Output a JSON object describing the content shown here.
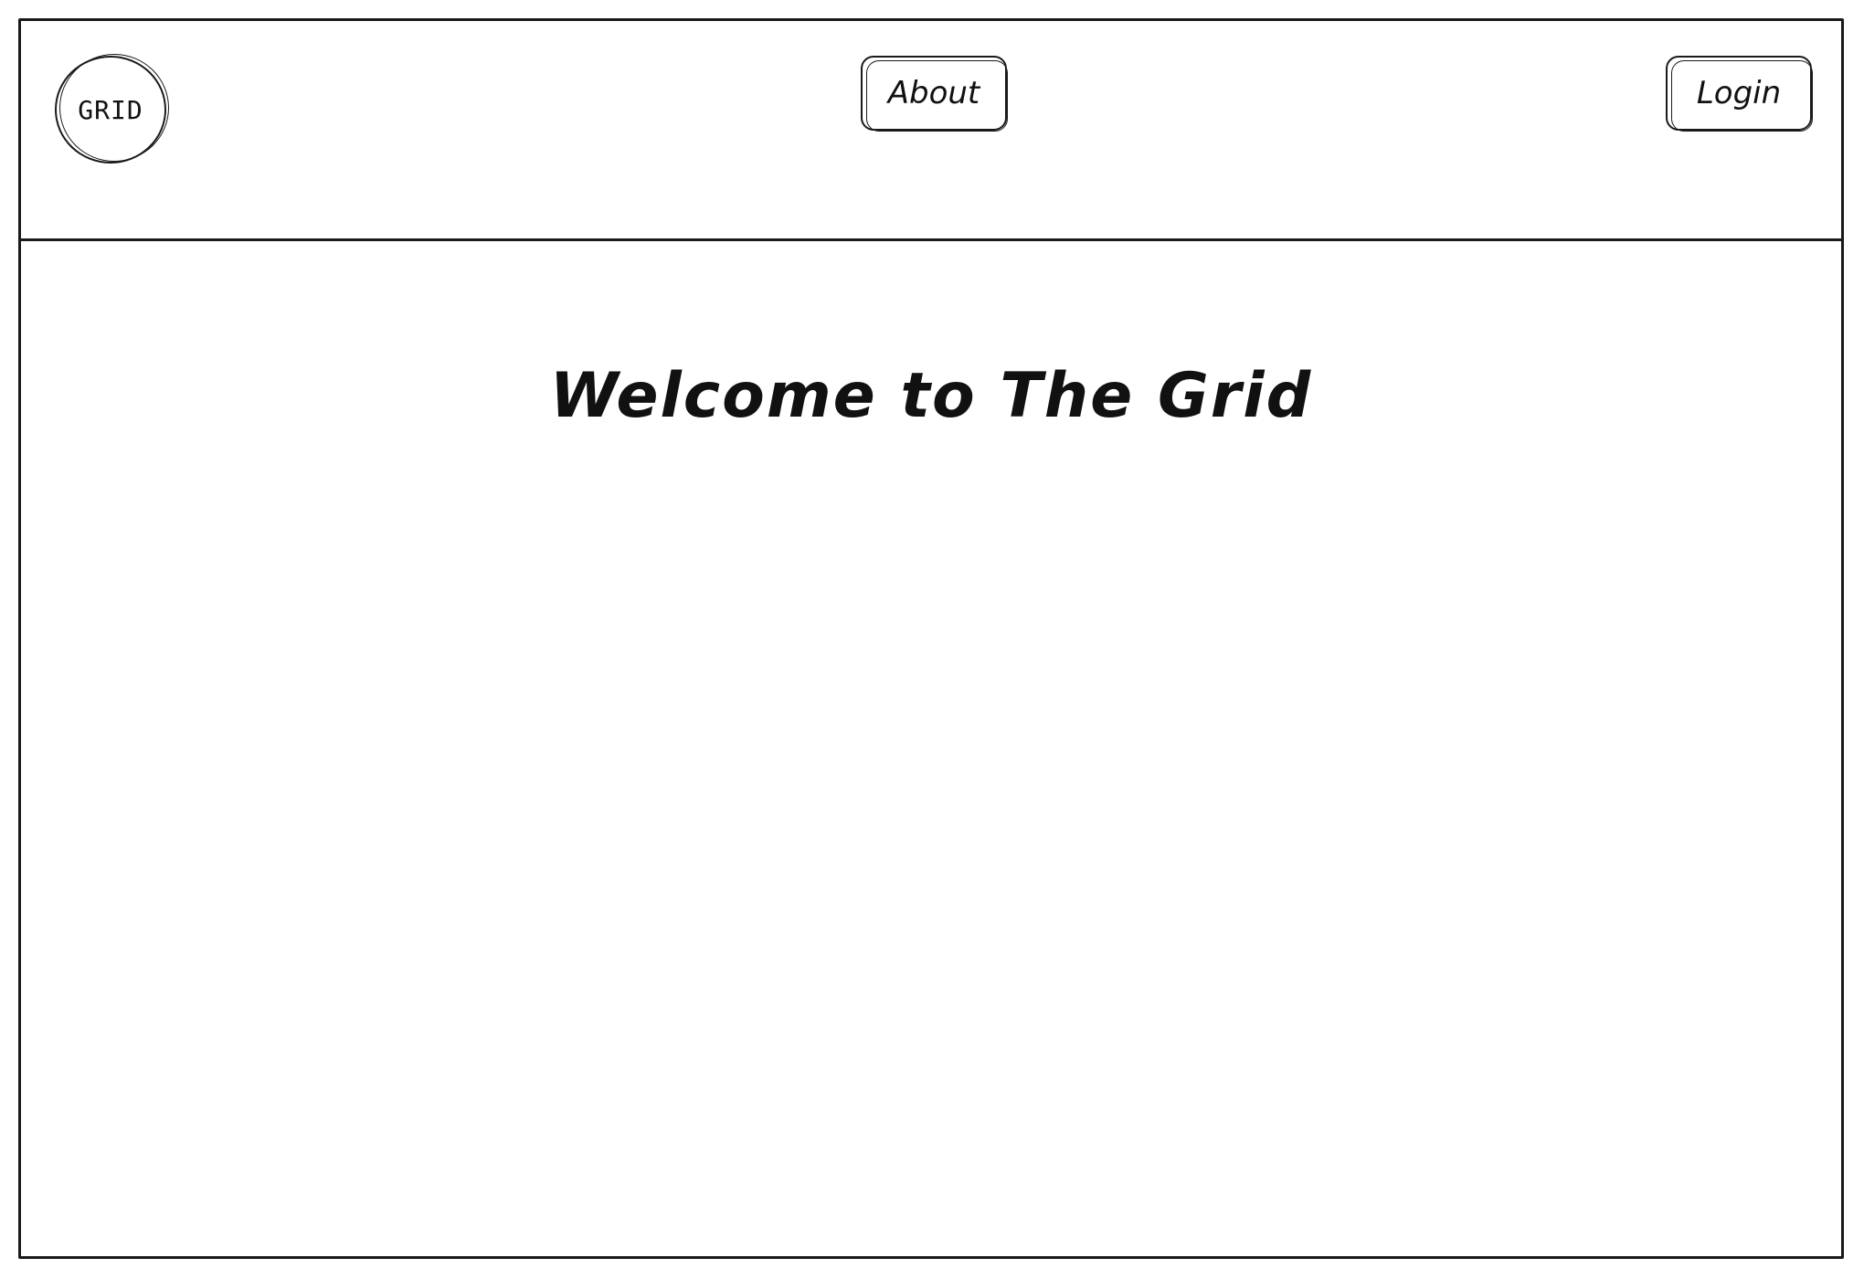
{
  "logo": {
    "text": "GRID"
  },
  "nav": {
    "about_label": "About",
    "login_label": "Login"
  },
  "main": {
    "welcome_title": "Welcome to The Grid"
  },
  "colors": {
    "stroke": "#1a1a1a",
    "background": "#ffffff",
    "text": "#111111"
  }
}
